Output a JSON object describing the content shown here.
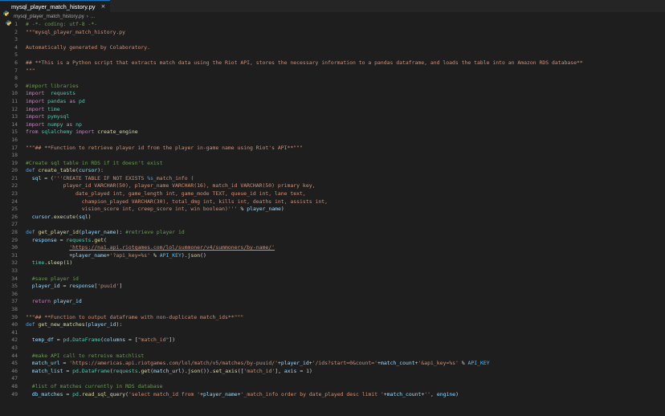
{
  "tab": {
    "filename": "mysql_player_match_history.py",
    "close_glyph": "×",
    "icon": "python-file-icon"
  },
  "breadcrumb": {
    "filename": "mysql_player_match_history.py",
    "ellipsis": "...",
    "icon": "python-file-icon"
  },
  "colors": {
    "background": "#1e1e1e",
    "comment": "#6a9955",
    "string": "#ce9178",
    "keyword": "#c586c0",
    "accent": "#007acc"
  },
  "lines": [
    {
      "n": "1",
      "t": [
        [
          "c-comment",
          "# -*- coding: utf-8 -*-"
        ]
      ]
    },
    {
      "n": "2",
      "t": [
        [
          "c-string",
          "\"\"\"mysql_player_match_history.py"
        ]
      ]
    },
    {
      "n": "3",
      "t": []
    },
    {
      "n": "4",
      "t": [
        [
          "c-string",
          "Automatically generated by Colaboratory."
        ]
      ]
    },
    {
      "n": "5",
      "t": []
    },
    {
      "n": "6",
      "t": [
        [
          "c-string",
          "## **This is a Python script that extracts match data using the Riot API, stores the necessary information to a pandas dataframe, and loads the table into an Amazon RDS database**"
        ]
      ]
    },
    {
      "n": "7",
      "t": [
        [
          "c-string",
          "\"\"\""
        ]
      ]
    },
    {
      "n": "8",
      "t": []
    },
    {
      "n": "9",
      "t": [
        [
          "c-comment",
          "#import libraries"
        ]
      ]
    },
    {
      "n": "10",
      "t": [
        [
          "c-keyword",
          "import"
        ],
        [
          "",
          "  "
        ],
        [
          "c-class",
          "requests"
        ]
      ]
    },
    {
      "n": "11",
      "t": [
        [
          "c-keyword",
          "import"
        ],
        [
          "",
          " "
        ],
        [
          "c-class",
          "pandas"
        ],
        [
          "",
          " "
        ],
        [
          "c-keyword",
          "as"
        ],
        [
          "",
          " "
        ],
        [
          "c-class",
          "pd"
        ]
      ]
    },
    {
      "n": "12",
      "t": [
        [
          "c-keyword",
          "import"
        ],
        [
          "",
          " "
        ],
        [
          "c-class",
          "time"
        ]
      ]
    },
    {
      "n": "13",
      "t": [
        [
          "c-keyword",
          "import"
        ],
        [
          "",
          " "
        ],
        [
          "c-class",
          "pymysql"
        ]
      ]
    },
    {
      "n": "14",
      "t": [
        [
          "c-keyword",
          "import"
        ],
        [
          "",
          " "
        ],
        [
          "c-class",
          "numpy"
        ],
        [
          "",
          " "
        ],
        [
          "c-keyword",
          "as"
        ],
        [
          "",
          " "
        ],
        [
          "c-class",
          "np"
        ]
      ]
    },
    {
      "n": "15",
      "t": [
        [
          "c-keyword",
          "from"
        ],
        [
          "",
          " "
        ],
        [
          "c-class",
          "sqlalchemy"
        ],
        [
          "",
          " "
        ],
        [
          "c-keyword",
          "import"
        ],
        [
          "",
          " "
        ],
        [
          "c-func",
          "create_engine"
        ]
      ]
    },
    {
      "n": "16",
      "t": []
    },
    {
      "n": "17",
      "t": [
        [
          "c-string",
          "\"\"\"## **Function to retrieve player id from the player in-game name using Riot's API**\"\"\""
        ]
      ]
    },
    {
      "n": "18",
      "t": []
    },
    {
      "n": "19",
      "t": [
        [
          "c-comment",
          "#Create sql table in RDS if it doesn't exist"
        ]
      ]
    },
    {
      "n": "20",
      "t": [
        [
          "c-def",
          "def"
        ],
        [
          "",
          " "
        ],
        [
          "c-func",
          "create_table"
        ],
        [
          "",
          "("
        ],
        [
          "c-var",
          "cursor"
        ],
        [
          "",
          "):"
        ]
      ]
    },
    {
      "n": "21",
      "t": [
        [
          "",
          "  "
        ],
        [
          "c-var",
          "sql"
        ],
        [
          "",
          " = ("
        ],
        [
          "c-string",
          "'''CREATE TABLE IF NOT EXISTS "
        ],
        [
          "c-def",
          "%s"
        ],
        [
          "c-string",
          "_match_info ("
        ]
      ]
    },
    {
      "n": "22",
      "t": [
        [
          "c-string",
          "            player_id VARCHAR(50), player_name VARCHAR(16), match_id VARCHAR(50) primary key,"
        ]
      ]
    },
    {
      "n": "23",
      "t": [
        [
          "c-string",
          "                date_played int, game_length int, game_mode TEXT, queue_id int, lane text,"
        ]
      ]
    },
    {
      "n": "24",
      "t": [
        [
          "c-string",
          "                  champion_played VARCHAR(30), total_dmg int, kills int, deaths int, assists int,"
        ]
      ]
    },
    {
      "n": "25",
      "t": [
        [
          "c-string",
          "                  vision_score int, creep_score int, win boolean)'''"
        ],
        [
          "",
          " % "
        ],
        [
          "c-var",
          "player_name"
        ],
        [
          "",
          ")"
        ]
      ]
    },
    {
      "n": "26",
      "t": [
        [
          "",
          "  "
        ],
        [
          "c-var",
          "cursor"
        ],
        [
          "",
          "."
        ],
        [
          "c-func",
          "execute"
        ],
        [
          "",
          "("
        ],
        [
          "c-var",
          "sql"
        ],
        [
          "",
          ")"
        ]
      ]
    },
    {
      "n": "27",
      "t": []
    },
    {
      "n": "28",
      "t": [
        [
          "c-def",
          "def"
        ],
        [
          "",
          " "
        ],
        [
          "c-func",
          "get_player_id"
        ],
        [
          "",
          "("
        ],
        [
          "c-var",
          "player_name"
        ],
        [
          "",
          "): "
        ],
        [
          "c-comment",
          "#retrieve player id"
        ]
      ]
    },
    {
      "n": "29",
      "t": [
        [
          "",
          "  "
        ],
        [
          "c-var",
          "response"
        ],
        [
          "",
          " = "
        ],
        [
          "c-class",
          "requests"
        ],
        [
          "",
          "."
        ],
        [
          "c-func",
          "get"
        ],
        [
          "",
          "("
        ]
      ]
    },
    {
      "n": "30",
      "t": [
        [
          "",
          "              "
        ],
        [
          "c-link",
          "'https://na1.api.riotgames.com/lol/summoner/v4/summoners/by-name/'"
        ]
      ]
    },
    {
      "n": "31",
      "t": [
        [
          "",
          "              +"
        ],
        [
          "c-var",
          "player_name"
        ],
        [
          "",
          "+"
        ],
        [
          "c-string",
          "'?api_key=%s'"
        ],
        [
          "",
          " % "
        ],
        [
          "c-const",
          "API_KEY"
        ],
        [
          "",
          ")."
        ],
        [
          "c-func",
          "json"
        ],
        [
          "",
          "()"
        ]
      ]
    },
    {
      "n": "32",
      "t": [
        [
          "",
          "  "
        ],
        [
          "c-class",
          "time"
        ],
        [
          "",
          "."
        ],
        [
          "c-func",
          "sleep"
        ],
        [
          "",
          "("
        ],
        [
          "c-num",
          "1"
        ],
        [
          "",
          ")"
        ]
      ]
    },
    {
      "n": "33",
      "t": []
    },
    {
      "n": "34",
      "t": [
        [
          "",
          "  "
        ],
        [
          "c-comment",
          "#save player id"
        ]
      ]
    },
    {
      "n": "35",
      "t": [
        [
          "",
          "  "
        ],
        [
          "c-var",
          "player_id"
        ],
        [
          "",
          " = "
        ],
        [
          "c-var",
          "response"
        ],
        [
          "",
          "["
        ],
        [
          "c-string",
          "'puuid'"
        ],
        [
          "",
          "]"
        ]
      ]
    },
    {
      "n": "36",
      "t": []
    },
    {
      "n": "37",
      "t": [
        [
          "",
          "  "
        ],
        [
          "c-keyword",
          "return"
        ],
        [
          "",
          " "
        ],
        [
          "c-var",
          "player_id"
        ]
      ]
    },
    {
      "n": "38",
      "t": []
    },
    {
      "n": "39",
      "t": [
        [
          "c-string",
          "\"\"\"## **Function to output dataframe with non-duplicate match_ids**\"\"\""
        ]
      ]
    },
    {
      "n": "40",
      "t": [
        [
          "c-def",
          "def"
        ],
        [
          "",
          " "
        ],
        [
          "c-func",
          "get_new_matches"
        ],
        [
          "",
          "("
        ],
        [
          "c-var",
          "player_id"
        ],
        [
          "",
          "):"
        ]
      ]
    },
    {
      "n": "41",
      "t": []
    },
    {
      "n": "42",
      "t": [
        [
          "",
          "  "
        ],
        [
          "c-var",
          "temp_df"
        ],
        [
          "",
          " = "
        ],
        [
          "c-class",
          "pd"
        ],
        [
          "",
          "."
        ],
        [
          "c-class",
          "DataFrame"
        ],
        [
          "",
          "("
        ],
        [
          "c-var",
          "columns"
        ],
        [
          "",
          " = ["
        ],
        [
          "c-string",
          "\"match_id\""
        ],
        [
          "",
          "])"
        ]
      ]
    },
    {
      "n": "43",
      "t": []
    },
    {
      "n": "44",
      "t": [
        [
          "",
          "  "
        ],
        [
          "c-comment",
          "#make API call to retreive matchlist"
        ]
      ]
    },
    {
      "n": "45",
      "t": [
        [
          "",
          "  "
        ],
        [
          "c-var",
          "match_url"
        ],
        [
          "",
          " = "
        ],
        [
          "c-string",
          "'https://americas.api.riotgames.com/lol/match/v5/matches/by-puuid/'"
        ],
        [
          "",
          "+"
        ],
        [
          "c-var",
          "player_id"
        ],
        [
          "",
          "+"
        ],
        [
          "c-string",
          "'/ids?start=0&count='"
        ],
        [
          "",
          "+"
        ],
        [
          "c-var",
          "match_count"
        ],
        [
          "",
          "+"
        ],
        [
          "c-string",
          "'&api_key=%s'"
        ],
        [
          "",
          " % "
        ],
        [
          "c-const",
          "API_KEY"
        ]
      ]
    },
    {
      "n": "46",
      "t": [
        [
          "",
          "  "
        ],
        [
          "c-var",
          "match_list"
        ],
        [
          "",
          " = "
        ],
        [
          "c-class",
          "pd"
        ],
        [
          "",
          "."
        ],
        [
          "c-class",
          "DataFrame"
        ],
        [
          "",
          "("
        ],
        [
          "c-class",
          "requests"
        ],
        [
          "",
          "."
        ],
        [
          "c-func",
          "get"
        ],
        [
          "",
          "("
        ],
        [
          "c-var",
          "match_url"
        ],
        [
          "",
          ")."
        ],
        [
          "c-func",
          "json"
        ],
        [
          "",
          "())."
        ],
        [
          "c-func",
          "set_axis"
        ],
        [
          "",
          "(["
        ],
        [
          "c-string",
          "'match_id'"
        ],
        [
          "",
          "], "
        ],
        [
          "c-var",
          "axis"
        ],
        [
          "",
          " = "
        ],
        [
          "c-num",
          "1"
        ],
        [
          "",
          ")"
        ]
      ]
    },
    {
      "n": "47",
      "t": []
    },
    {
      "n": "48",
      "t": [
        [
          "",
          "  "
        ],
        [
          "c-comment",
          "#list of matches currently in RDS database"
        ]
      ]
    },
    {
      "n": "49",
      "t": [
        [
          "",
          "  "
        ],
        [
          "c-var",
          "db_matches"
        ],
        [
          "",
          " = "
        ],
        [
          "c-class",
          "pd"
        ],
        [
          "",
          "."
        ],
        [
          "c-func",
          "read_sql_query"
        ],
        [
          "",
          "("
        ],
        [
          "c-string",
          "'select match_id from '"
        ],
        [
          "",
          "+"
        ],
        [
          "c-var",
          "player_name"
        ],
        [
          "",
          "+"
        ],
        [
          "c-string",
          "'_match_info order by date_played desc limit '"
        ],
        [
          "",
          "+"
        ],
        [
          "c-var",
          "match_count"
        ],
        [
          "",
          "+"
        ],
        [
          "c-string",
          "''"
        ],
        [
          "",
          ", "
        ],
        [
          "c-var",
          "engine"
        ],
        [
          "",
          ")"
        ]
      ]
    }
  ]
}
